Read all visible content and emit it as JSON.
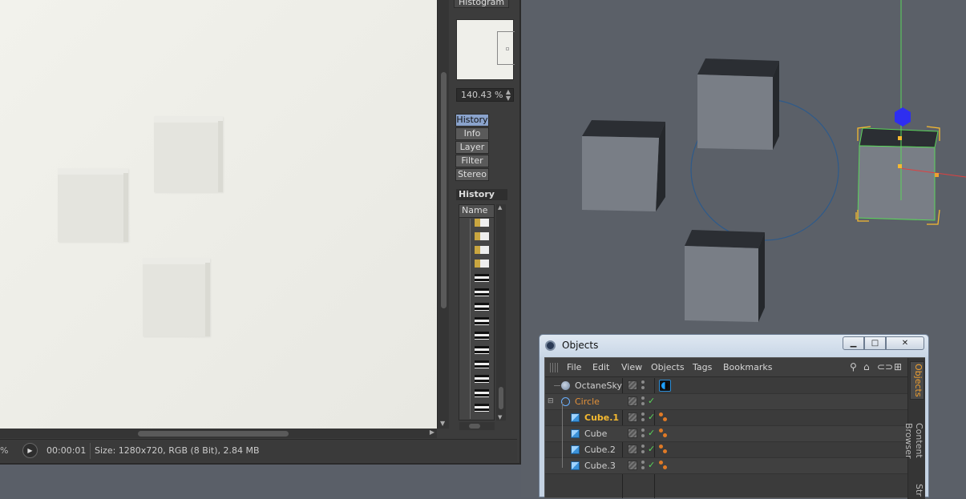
{
  "picture_viewer": {
    "histogram_tab": "Histogram",
    "zoom_value": "140.43 %",
    "tabs": [
      "History",
      "Info",
      "Layer",
      "Filter",
      "Stereo"
    ],
    "active_tab": "History",
    "history_header": "History",
    "history_column": "Name",
    "status": {
      "zoom_fragment": "%",
      "timecode": "00:00:01",
      "size_info": "Size: 1280x720, RGB (8 Bit), 2.84 MB"
    }
  },
  "object_manager": {
    "title": "Objects",
    "menu": [
      "File",
      "Edit",
      "View",
      "Objects",
      "Tags",
      "Bookmarks"
    ],
    "rows": [
      {
        "name": "OctaneSky",
        "color": "#cfcfcf",
        "icon": "sky-icon"
      },
      {
        "name": "Circle",
        "color": "#e3913a",
        "icon": "circle-icon"
      },
      {
        "name": "Cube.1",
        "color": "#f5b930",
        "icon": "cube-icon"
      },
      {
        "name": "Cube",
        "color": "#cfcfcf",
        "icon": "cube-icon"
      },
      {
        "name": "Cube.2",
        "color": "#cfcfcf",
        "icon": "cube-icon"
      },
      {
        "name": "Cube.3",
        "color": "#cfcfcf",
        "icon": "cube-icon"
      }
    ],
    "side_tabs": [
      "Objects",
      "Content Browser",
      "Str"
    ]
  },
  "colors": {
    "selection_yellow": "#f5b930",
    "selection_green": "#5ad45a",
    "axis_blue": "#2e2ef0",
    "viewport_bg": "#5b6068"
  }
}
